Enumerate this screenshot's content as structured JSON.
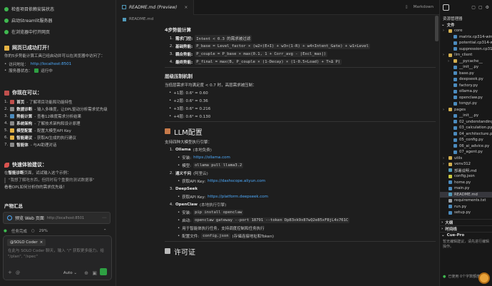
{
  "chat": {
    "top_items": [
      "检查项目依赖安装状态",
      "启动Streamlit服务器",
      "在浏览器中打开网页"
    ],
    "success_title": "网页已成功打开！",
    "success_desc": "你的5步势能计算工具已经启动并可以在浏览器中访问了：",
    "access_label": "访问地址：",
    "access_url": "http://localhost:8501",
    "service_label": "服务器状态：",
    "service_status": "运行中",
    "can_do_title": "你现在可以：",
    "can_do": [
      {
        "no": "1.",
        "label": "首页",
        "text": " - 了解项目功能和功能特性"
      },
      {
        "no": "2.",
        "label": "数据诊断",
        "text": " - 输入多维度，让DPL驱动分析需求优先级"
      },
      {
        "no": "3.",
        "label": "势能计算",
        "text": " - 查看12维度需求分析结果"
      },
      {
        "no": "4.",
        "label": "系统架构",
        "text": " - 了解技术架构和设计原理"
      },
      {
        "no": "5.",
        "label": "模型配置",
        "text": " - 配置大模型API Key"
      },
      {
        "no": "6.",
        "label": "智能建议",
        "text": " - 获取AI生成的执行建议"
      },
      {
        "no": "7.",
        "label": "智能体",
        "text": " - 与AI助理对话"
      }
    ],
    "quick_title": "快速体验建议：",
    "quick_desc_pre": "在",
    "quick_desc_b": "智能诊断",
    "quick_desc_post": "页面，试试输入这个示例：",
    "quote": "\"我想了解吃东西，但同时有个重要的测试数据事\"",
    "quick_tail": "看看DPL如何分析你的需求优先级！",
    "product_title": "产物汇总",
    "product_item": "预览 Web 页面",
    "product_url": "http://localhost:8501",
    "task_status": "任务完成",
    "task_progress": "29%",
    "agent_chip": "@SOLO Coder",
    "input_placeholder": "在此与 SOLO Coder 聊天，输入 \"/\" 获取更多能力。给 \"/plan\", \"/spec\"",
    "model_label": "Auto"
  },
  "editor": {
    "tab_label": "README.md (Preview)",
    "breadcrumb": "README.md",
    "preview_label": "Markdown",
    "model_section": {
      "title": "4步势能计算",
      "lines": [
        {
          "no": "1.",
          "b": "需求门控:",
          "code": "Intent < 0.3 的需求被过滤"
        },
        {
          "no": "2.",
          "b": "基础势能:",
          "code": "P_base = Level_factor × (w2×(E+I) + w3×(1-R) + w4×Intent_Gate) + w1×Level"
        },
        {
          "no": "3.",
          "b": "耦合势能:",
          "code": "P_couple = P_base × max(0.1, 1 + Corr_avg - |Excl_max|)"
        },
        {
          "no": "4.",
          "b": "最终势能:",
          "code": "P_final = max(B, P_couple × (1-Decay) × (1-0.5×Load) + T×Δ P)"
        }
      ]
    },
    "hier_section": {
      "title": "层级压制机制",
      "desc": "当低层需求平均满足度 < 0.7 时，高层需求被压制：",
      "lines": [
        "+1层: 0.6² = 0.60",
        "+2层: 0.6² = 0.36",
        "+3层: 0.6³ = 0.216",
        "+4层: 0.6⁴ = 0.130"
      ]
    },
    "llm_section": {
      "title": "LLM配置",
      "desc": "支持四种大模型执行引擎：",
      "items": [
        {
          "no": "1.",
          "name": "Ollama",
          "note": "(本地免费)",
          "subs": [
            {
              "label": "安装: ",
              "link": "https://ollama.com"
            },
            {
              "label": "模型: ",
              "code": "ollama pull llama3.2"
            }
          ]
        },
        {
          "no": "2.",
          "name": "通义千问",
          "note": "(阿里云)",
          "subs": [
            {
              "label": "获取API Key: ",
              "link": "https://dashscope.aliyun.com"
            }
          ]
        },
        {
          "no": "3.",
          "name": "DeepSeek",
          "note": "",
          "subs": [
            {
              "label": "获取API Key: ",
              "link": "https://platform.deepseek.com"
            }
          ]
        },
        {
          "no": "4.",
          "name": "OpenClaw",
          "note": "(本地执行引擎)",
          "subs": [
            {
              "label": "安装: ",
              "code": "pip install openclaw"
            },
            {
              "label": "启动: ",
              "code": "openclaw gateway --port 18791 --token Dp83xk9x87wQ2e85xF8jL4s761C"
            },
            {
              "label": "用于智能体执行任务，支持调度控制和任务执行"
            },
            {
              "label": "配置文件: ",
              "code": "config.json",
              "tail": " (存储连接地址和Token)"
            }
          ]
        }
      ]
    },
    "license_title": "许可证"
  },
  "explorer": {
    "title": "资源管理器",
    "section_files": "文件",
    "tree": [
      {
        "d": 0,
        "t": "folder",
        "n": "core"
      },
      {
        "d": 1,
        "t": "py",
        "n": "matrix.cp314-win..."
      },
      {
        "d": 1,
        "t": "py",
        "n": "potential.cp314-w..."
      },
      {
        "d": 1,
        "t": "py",
        "n": "suppression.cp314..."
      },
      {
        "d": 0,
        "t": "folder",
        "n": "llm_client"
      },
      {
        "d": 1,
        "t": "folder",
        "n": "__pycache__"
      },
      {
        "d": 1,
        "t": "py",
        "n": "__init__.py"
      },
      {
        "d": 1,
        "t": "py",
        "n": "base.py"
      },
      {
        "d": 1,
        "t": "py",
        "n": "deepseek.py"
      },
      {
        "d": 1,
        "t": "py",
        "n": "factory.py"
      },
      {
        "d": 1,
        "t": "py",
        "n": "ollama.py"
      },
      {
        "d": 1,
        "t": "py",
        "n": "openclaw.py"
      },
      {
        "d": 1,
        "t": "py",
        "n": "tongyi.py"
      },
      {
        "d": 0,
        "t": "folder",
        "n": "pages"
      },
      {
        "d": 1,
        "t": "py",
        "n": "__init__.py"
      },
      {
        "d": 1,
        "t": "py",
        "n": "02_understanding..."
      },
      {
        "d": 1,
        "t": "py",
        "n": "03_calculation.py"
      },
      {
        "d": 1,
        "t": "py",
        "n": "04_architecture.py"
      },
      {
        "d": 1,
        "t": "py",
        "n": "05_config.py"
      },
      {
        "d": 1,
        "t": "py",
        "n": "06_ai_advice.py"
      },
      {
        "d": 1,
        "t": "py",
        "n": "07_agent.py"
      },
      {
        "d": 0,
        "t": "folder",
        "n": "utils"
      },
      {
        "d": 0,
        "t": "folder",
        "n": "venv312"
      },
      {
        "d": 0,
        "t": "md",
        "n": "部署说明.md"
      },
      {
        "d": 0,
        "t": "json",
        "n": "config.json"
      },
      {
        "d": 0,
        "t": "py",
        "n": "home.py"
      },
      {
        "d": 0,
        "t": "py",
        "n": "main.py"
      },
      {
        "d": 0,
        "t": "md",
        "n": "README.md",
        "sel": true
      },
      {
        "d": 0,
        "t": "txt",
        "n": "requirements.txt"
      },
      {
        "d": 0,
        "t": "py",
        "n": "run.py"
      },
      {
        "d": 0,
        "t": "py",
        "n": "setup.py"
      }
    ],
    "section_outline": "大纲",
    "section_timeline": "时间线",
    "section_cue": "Cue-Pro",
    "cue_text": "暂无编辑建议，请先进行编辑操作。",
    "status_text": "已使用 0个字数额度"
  },
  "colors": {
    "accent": "#3fb950",
    "link": "#4daafc",
    "folder": "#d4b050",
    "py": "#4b8bbe",
    "md": "#519aba",
    "json": "#cbcb41",
    "txt": "#9aa0a6"
  }
}
